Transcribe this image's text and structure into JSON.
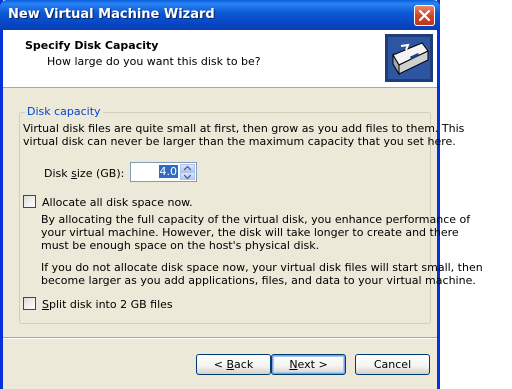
{
  "window": {
    "title": "New Virtual Machine Wizard"
  },
  "header": {
    "title": "Specify Disk Capacity",
    "subtitle": "How large do you want this disk to be?"
  },
  "group": {
    "legend": "Disk capacity",
    "intro_line1": "Virtual disk files are quite small at first, then grow as you add files to them. This",
    "intro_line2": "virtual disk can never be larger than the maximum capacity that you set here."
  },
  "disk_size": {
    "label_pre": "Disk ",
    "label_accel": "s",
    "label_post": "ize (GB):",
    "value": "4.0"
  },
  "allocate": {
    "label": "Allocate all disk space now.",
    "checked": false,
    "desc_line1": "By allocating the full capacity of the virtual disk, you enhance performance of",
    "desc_line2": "your virtual machine.  However, the disk will take longer to create and there",
    "desc_line3": "must be enough space on the host's physical disk.",
    "desc_line4": "If you do not allocate disk space now, your virtual disk files will start small, then",
    "desc_line5": "become larger as you add applications, files, and data to your virtual machine."
  },
  "split": {
    "label_pre": "",
    "label_accel": "S",
    "label_post": "plit disk into 2 GB files",
    "checked": false
  },
  "buttons": {
    "back_pre": "< ",
    "back_accel": "B",
    "back_post": "ack",
    "next_accel": "N",
    "next_post": "ext >",
    "cancel": "Cancel"
  }
}
